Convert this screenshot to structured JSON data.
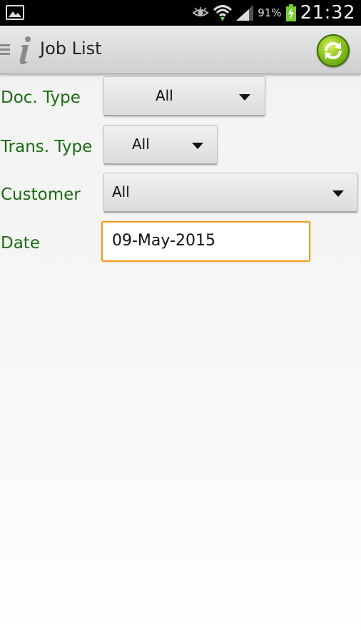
{
  "status_bar": {
    "icons": [
      "gallery-icon",
      "eye-icon",
      "wifi-icon",
      "signal-icon",
      "battery-charging-icon"
    ],
    "battery_percent": "91%",
    "time": "21:32"
  },
  "action_bar": {
    "title": "Job List",
    "icons": [
      "menu-icon",
      "info-icon",
      "refresh-icon"
    ]
  },
  "form": {
    "doc_type": {
      "label": "Doc. Type",
      "value": "All"
    },
    "trans_type": {
      "label": "Trans. Type",
      "value": "All"
    },
    "customer": {
      "label": "Customer",
      "value": "All"
    },
    "date": {
      "label": "Date",
      "value": "09-May-2015"
    }
  },
  "colors": {
    "label_green": "#1b6b12",
    "focus_orange": "#f39a1f",
    "refresh_green": "#8cc41e"
  }
}
